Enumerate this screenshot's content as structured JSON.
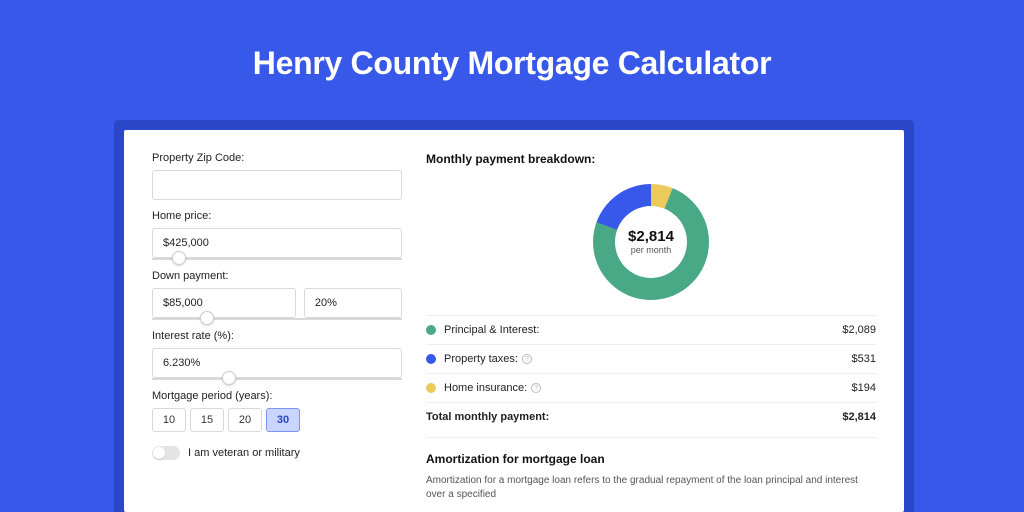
{
  "page_title": "Henry County Mortgage Calculator",
  "form": {
    "zip": {
      "label": "Property Zip Code:",
      "value": ""
    },
    "home_price": {
      "label": "Home price:",
      "value": "$425,000",
      "slider_pos_pct": 8
    },
    "down_payment": {
      "label": "Down payment:",
      "value": "$85,000",
      "pct_value": "20%",
      "slider_pos_pct": 19
    },
    "interest_rate": {
      "label": "Interest rate (%):",
      "value": "6.230%",
      "slider_pos_pct": 28
    },
    "period": {
      "label": "Mortgage period (years):",
      "options": [
        "10",
        "15",
        "20",
        "30"
      ],
      "selected": "30"
    },
    "veteran": {
      "label": "I am veteran or military",
      "on": false
    }
  },
  "breakdown": {
    "title": "Monthly payment breakdown:",
    "center_amount": "$2,814",
    "center_sub": "per month",
    "items": [
      {
        "label": "Principal & Interest:",
        "value": "$2,089",
        "color": "#49a986",
        "info": false
      },
      {
        "label": "Property taxes:",
        "value": "$531",
        "color": "#3858e9",
        "info": true
      },
      {
        "label": "Home insurance:",
        "value": "$194",
        "color": "#ebc95a",
        "info": true
      }
    ],
    "total": {
      "label": "Total monthly payment:",
      "value": "$2,814"
    }
  },
  "amortization": {
    "title": "Amortization for mortgage loan",
    "text": "Amortization for a mortgage loan refers to the gradual repayment of the loan principal and interest over a specified"
  },
  "chart_data": {
    "type": "pie",
    "title": "Monthly payment breakdown",
    "series": [
      {
        "name": "Principal & Interest",
        "value": 2089,
        "color": "#49a986"
      },
      {
        "name": "Property taxes",
        "value": 531,
        "color": "#3858e9"
      },
      {
        "name": "Home insurance",
        "value": 194,
        "color": "#ebc95a"
      }
    ],
    "total": 2814,
    "center_label": "$2,814 per month"
  }
}
